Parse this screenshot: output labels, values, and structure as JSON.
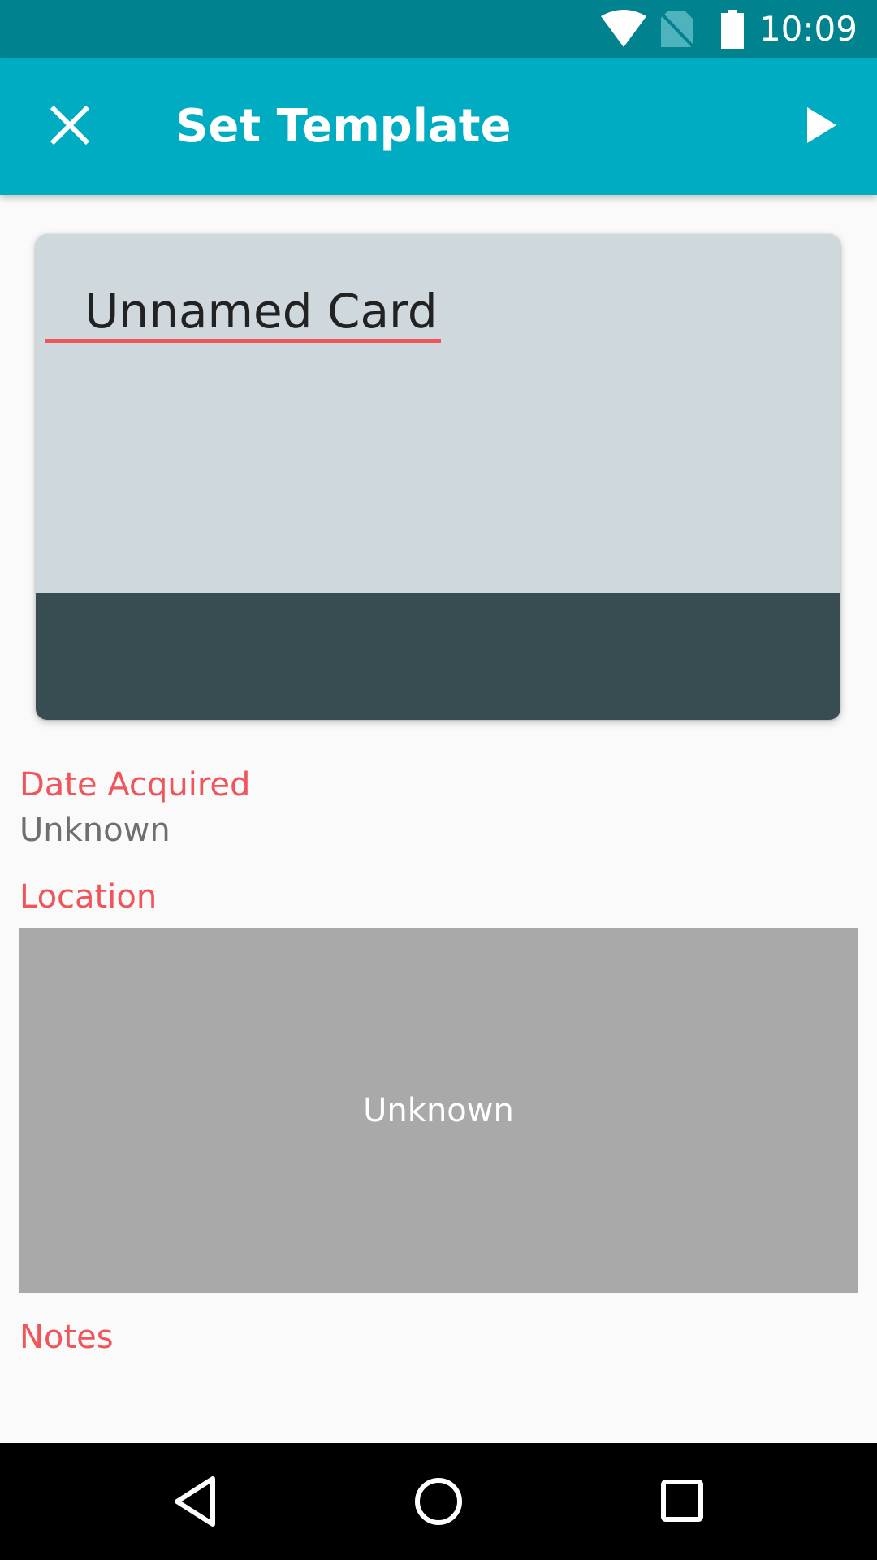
{
  "status_bar": {
    "time": "10:09",
    "icons": [
      "wifi-icon",
      "no-sim-icon",
      "battery-icon"
    ]
  },
  "app_bar": {
    "title": "Set Template",
    "close_icon": "close-icon",
    "next_icon": "play-icon",
    "color": "#00acc1"
  },
  "card": {
    "name_value": "Unnamed Card",
    "top_color": "#cfd8dc",
    "bottom_color": "#374d51",
    "accent_color": "#f0555a"
  },
  "fields": {
    "date_acquired_label": "Date Acquired",
    "date_acquired_value": "Unknown",
    "location_label": "Location",
    "location_value": "Unknown",
    "notes_label": "Notes"
  },
  "nav_bar": {
    "icons": [
      "back-icon",
      "home-icon",
      "recents-icon"
    ]
  }
}
